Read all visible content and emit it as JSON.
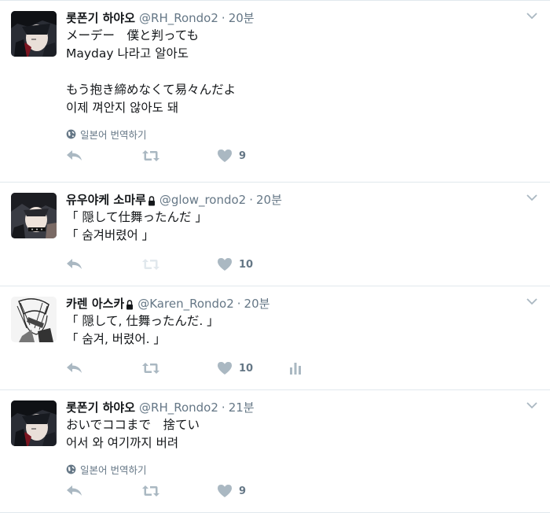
{
  "tweets": [
    {
      "name": "롯폰기 하야오",
      "handle": "@RH_Rondo2",
      "time": "20분",
      "text": "メーデー　僕と判っても\nMayday 나라고 알아도\n\nもう抱き締めなくて易々んだよ\n이제 껴안지 않아도 돼",
      "translate": "일본어 번역하기",
      "likes": "9",
      "locked": false
    },
    {
      "name": "유우야케 소마루",
      "handle": "@glow_rondo2",
      "time": "20분",
      "text": "「 隠して仕舞ったんだ 」\n「 숨겨버렸어 」",
      "likes": "10",
      "locked": true
    },
    {
      "name": "카렌 아스카",
      "handle": "@Karen_Rondo2",
      "time": "20분",
      "text": "「 隠して, 仕舞ったんだ. 」\n「 숨겨, 버렸어. 」",
      "likes": "10",
      "locked": true
    },
    {
      "name": "롯폰기 하야오",
      "handle": "@RH_Rondo2",
      "time": "21분",
      "text": "おいでココまで　捨てい\n어서 와 여기까지 버려",
      "translate": "일본어 번역하기",
      "likes": "9",
      "locked": false
    }
  ],
  "separator": "·",
  "colors": {
    "muted": "#657786",
    "icon": "#aab8c2",
    "background": "#e6ecf0"
  }
}
